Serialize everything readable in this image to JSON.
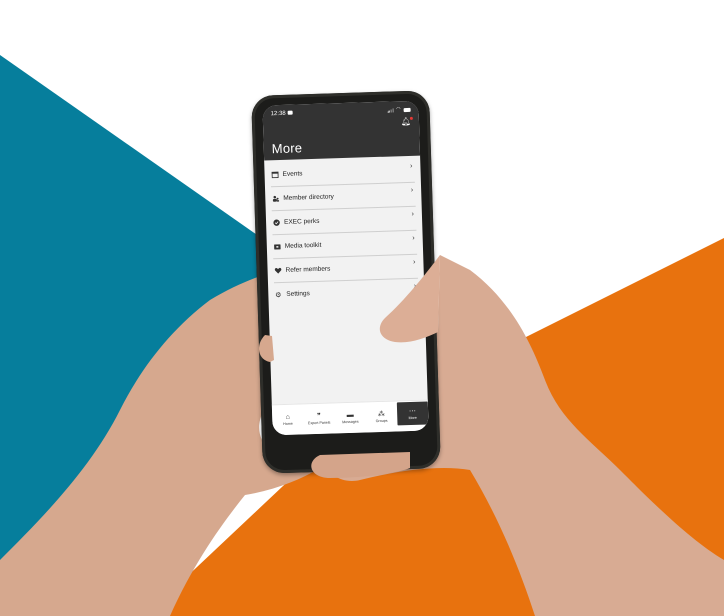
{
  "background": {
    "colors": {
      "teal": "#067e9c",
      "orange": "#e8720e",
      "white": "#ffffff"
    }
  },
  "phone": {
    "status_bar": {
      "time": "12:38",
      "icons": [
        "message-icon",
        "signal-icon",
        "wifi-icon",
        "battery-icon"
      ]
    },
    "header": {
      "title": "More",
      "notification_icon": "bell-icon",
      "has_notification": true
    },
    "menu": [
      {
        "label": "Events",
        "icon": "calendar-icon"
      },
      {
        "label": "Member directory",
        "icon": "people-icon"
      },
      {
        "label": "EXEC perks",
        "icon": "badge-icon"
      },
      {
        "label": "Media toolkit",
        "icon": "folder-icon"
      },
      {
        "label": "Refer members",
        "icon": "heart-handshake-icon"
      },
      {
        "label": "Settings",
        "icon": "gear-icon"
      }
    ],
    "tabs": [
      {
        "label": "Home",
        "icon": "home-icon",
        "active": false
      },
      {
        "label": "Expert Panels",
        "icon": "quote-icon",
        "active": false
      },
      {
        "label": "Messages",
        "icon": "chat-icon",
        "active": false
      },
      {
        "label": "Groups",
        "icon": "groups-icon",
        "active": false
      },
      {
        "label": "More",
        "icon": "more-icon",
        "active": true
      }
    ],
    "chevron": "›",
    "colors": {
      "header_bg": "#333333",
      "screen_bg": "#f2f2f2",
      "active_tab": "#333333",
      "badge": "#e53935"
    }
  }
}
